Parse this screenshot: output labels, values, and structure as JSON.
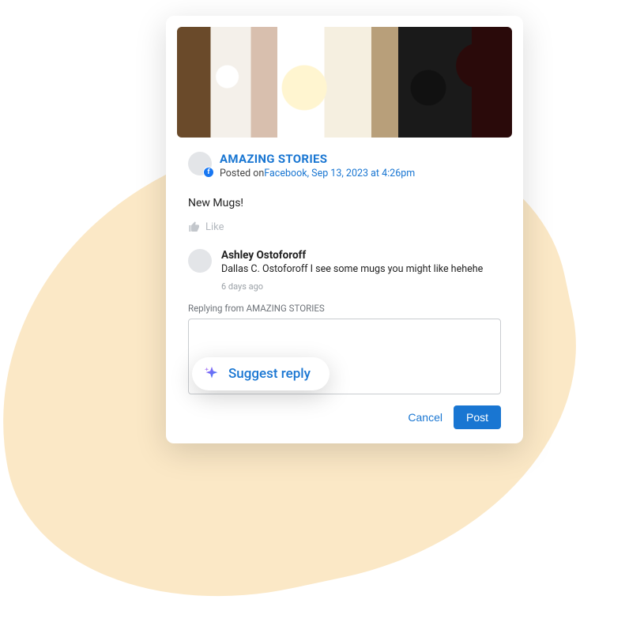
{
  "post": {
    "page_name": "AMAZING STORIES",
    "posted_prefix": "Posted on",
    "posted_link": "Facebook, Sep 13, 2023 at 4:26pm",
    "body": "New Mugs!",
    "like_label": "Like",
    "fb_badge_glyph": "f"
  },
  "comment": {
    "author": "Ashley Ostoforoff",
    "text": "Dallas C. Ostoforoff I see some mugs you might like hehehe",
    "time": "6 days ago"
  },
  "reply": {
    "label_prefix": "Replying from",
    "label_page": "AMAZING STORIES",
    "value": ""
  },
  "actions": {
    "cancel": "Cancel",
    "post": "Post"
  },
  "suggest": {
    "label": "Suggest reply"
  }
}
